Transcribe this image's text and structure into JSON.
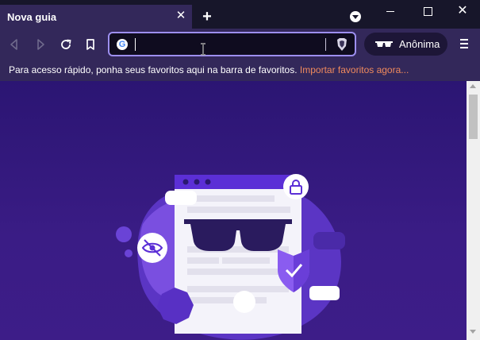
{
  "tab": {
    "title": "Nova guia",
    "close": "✕"
  },
  "new_tab": "+",
  "window": {
    "close": "✕"
  },
  "urlbar": {
    "value": "",
    "google_letter": "G"
  },
  "private": {
    "label": "Anônima"
  },
  "bookmarks_bar": {
    "message": "Para acesso rápido, ponha seus favoritos aqui na barra de favoritos. ",
    "import_link": "Importar favoritos agora..."
  },
  "colors": {
    "tab_bg": "#33285a",
    "titlebar": "#17162a",
    "accent_link": "#f08a5d",
    "content_bg": "#2b1573",
    "url_border": "#9d8ff0"
  }
}
